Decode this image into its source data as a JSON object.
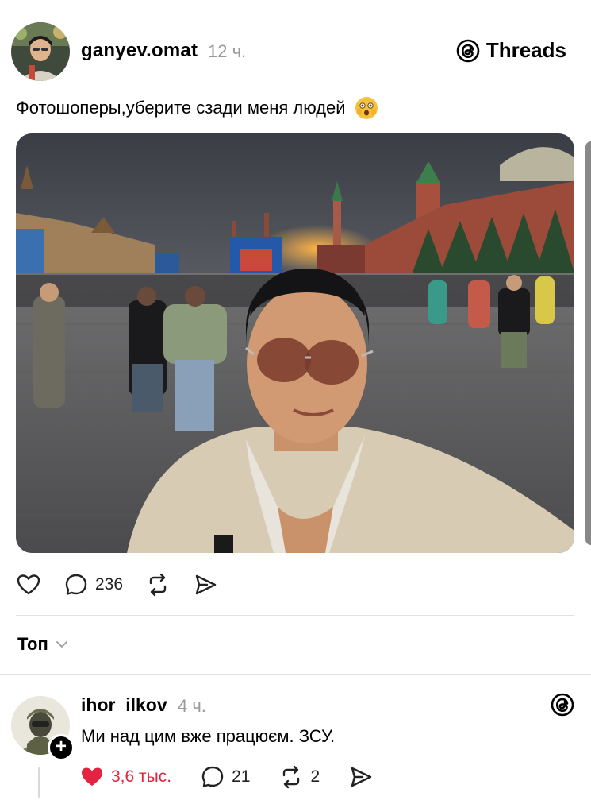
{
  "post": {
    "username": "ganyev.omat",
    "time": "12 ч.",
    "caption": "Фотошоперы,уберите сзади меня людей",
    "brand": "Threads",
    "replies_count": "236"
  },
  "sort": {
    "label": "Топ"
  },
  "reply": {
    "username": "ihor_ilkov",
    "time": "4 ч.",
    "text": "Ми над цим вже працюєм. ЗСУ.",
    "likes": "3,6 тыс.",
    "replies": "21",
    "reposts": "2"
  },
  "colors": {
    "like_red": "#e5223f",
    "muted": "#999999"
  }
}
